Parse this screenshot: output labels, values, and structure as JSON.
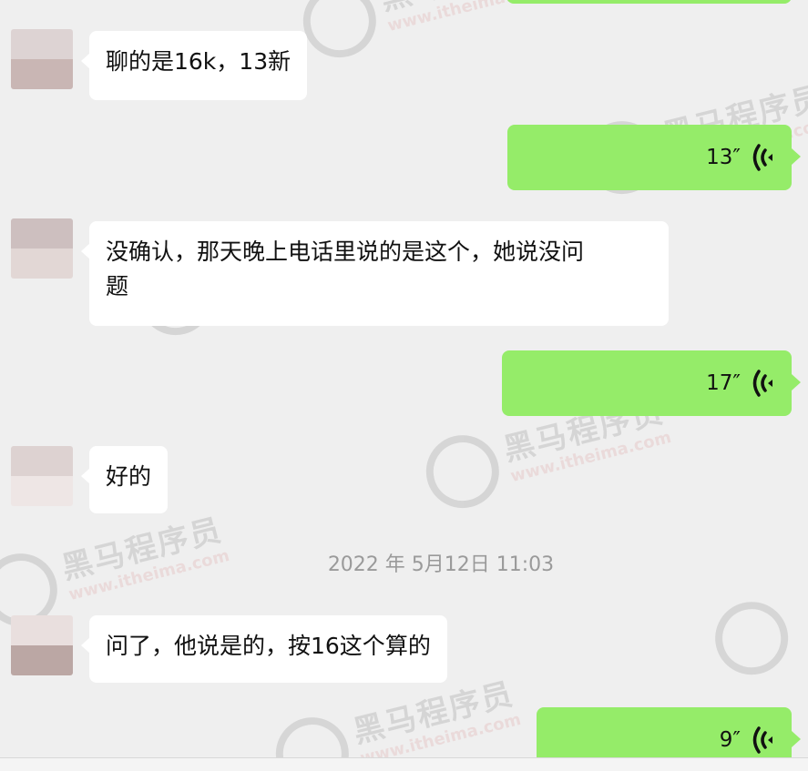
{
  "watermark": {
    "cn": "黑马程序员",
    "url": "www.itheima.com"
  },
  "messages": [
    {
      "kind": "text",
      "text": "聊的是16k，13新"
    },
    {
      "kind": "voice",
      "duration": "13″"
    },
    {
      "kind": "text",
      "line1": "没确认，那天晚上电话里说的是这个，她说没问",
      "line2": "题"
    },
    {
      "kind": "voice",
      "duration": "17″"
    },
    {
      "kind": "text",
      "text": "好的"
    },
    {
      "kind": "time",
      "text": "2022 年 5月12日 11:03"
    },
    {
      "kind": "text",
      "text": "问了，他说是的，按16这个算的"
    },
    {
      "kind": "voice",
      "duration": "9″"
    }
  ],
  "colors": {
    "background": "#efefef",
    "incoming_bubble": "#ffffff",
    "outgoing_bubble": "#95ec69"
  },
  "icons": {
    "voice": "voice-wave-icon",
    "avatar": "avatar"
  }
}
